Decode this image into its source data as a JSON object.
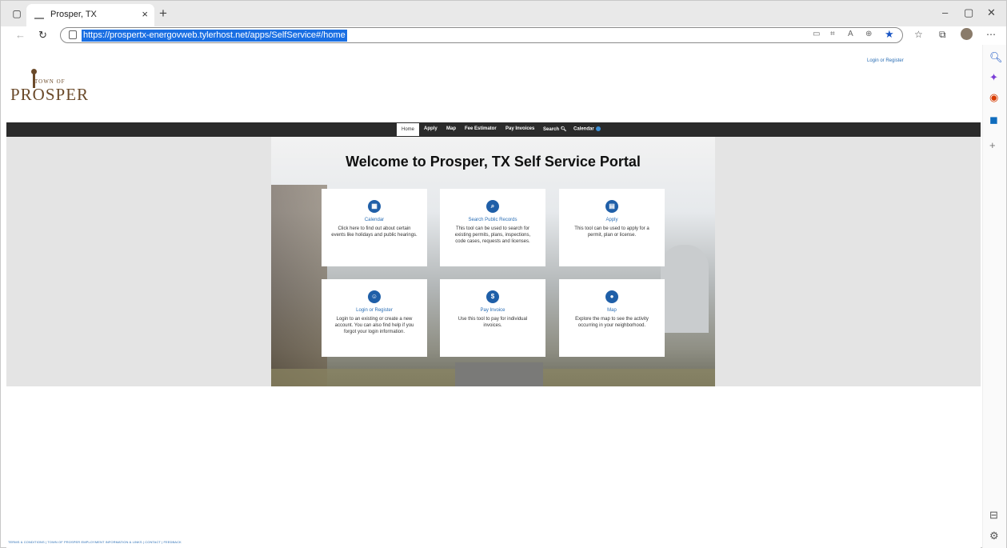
{
  "browser": {
    "tab_title": "Prosper, TX",
    "new_tab": "+",
    "url": "https://prospertx-energovweb.tylerhost.net/apps/SelfService#/home",
    "window_controls": [
      "–",
      "▢",
      "✕"
    ]
  },
  "site": {
    "logo_town_of": "TOWN OF",
    "logo_name": "PROSPER",
    "login_link": "Login or Register",
    "nav": [
      "Home",
      "Apply",
      "Map",
      "Fee Estimator",
      "Pay Invoices",
      "Search",
      "Calendar"
    ],
    "welcome": "Welcome to Prosper, TX Self Service Portal",
    "cards": [
      {
        "title": "Calendar",
        "desc": "Click here to find out about certain events like holidays and public hearings.",
        "icon": "calendar-icon"
      },
      {
        "title": "Search Public Records",
        "desc": "This tool can be used to search for existing permits, plans, inspections, code cases, requests and licenses.",
        "icon": "search-icon"
      },
      {
        "title": "Apply",
        "desc": "This tool can be used to apply for a permit, plan or license.",
        "icon": "clipboard-icon"
      },
      {
        "title": "Login or Register",
        "desc": "Login to an existing or create a new account. You can also find help if you forgot your login information.",
        "icon": "users-icon"
      },
      {
        "title": "Pay Invoice",
        "desc": "Use this tool to pay for individual invoices.",
        "icon": "dollar-icon"
      },
      {
        "title": "Map",
        "desc": "Explore the map to see the activity occurring in your neighborhood.",
        "icon": "map-pin-icon"
      }
    ],
    "footer": "TERMS & CONDITIONS | TOWN OF PROSPER EMPLOYMENT INFORMATION & LINKS | CONTACT | FEEDBACK"
  }
}
